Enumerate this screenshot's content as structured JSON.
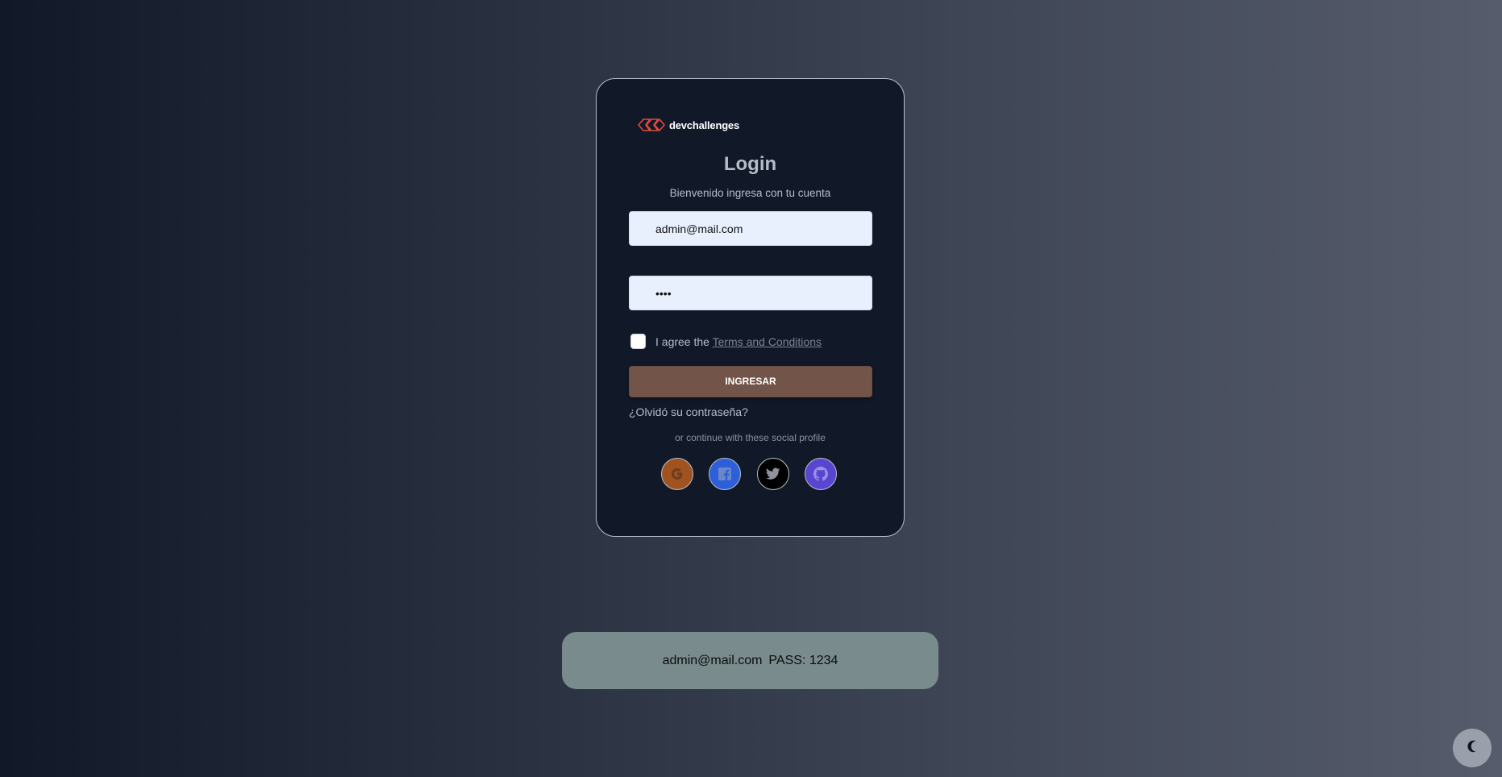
{
  "brand": {
    "name": "devchallenges",
    "accent": "#e04b3c"
  },
  "login": {
    "title": "Login",
    "subtitle": "Bienvenido ingresa con tu cuenta",
    "email_value": "admin@mail.com",
    "password_value": "1234",
    "terms_prefix": "I agree the",
    "terms_link": "Terms and Conditions",
    "submit_label": "INGRESAR",
    "forgot_label": "¿Olvidó su contraseña?",
    "social_caption": "or continue with these social profile",
    "social": [
      {
        "name": "google",
        "icon": "google-icon",
        "color": "#a0521f"
      },
      {
        "name": "facebook",
        "icon": "facebook-icon",
        "color": "#2c5fd8"
      },
      {
        "name": "twitter",
        "icon": "twitter-icon",
        "color": "#000000"
      },
      {
        "name": "github",
        "icon": "github-icon",
        "color": "#5846d0"
      }
    ]
  },
  "hint": {
    "email": "admin@mail.com",
    "pass_label": "PASS: 1234"
  },
  "theme_toggle": {
    "icon": "moon-icon"
  },
  "colors": {
    "card_bg": "#111827",
    "submit_bg": "#735449",
    "hint_bg": "#798b8d",
    "input_bg": "#e8f0fe"
  }
}
